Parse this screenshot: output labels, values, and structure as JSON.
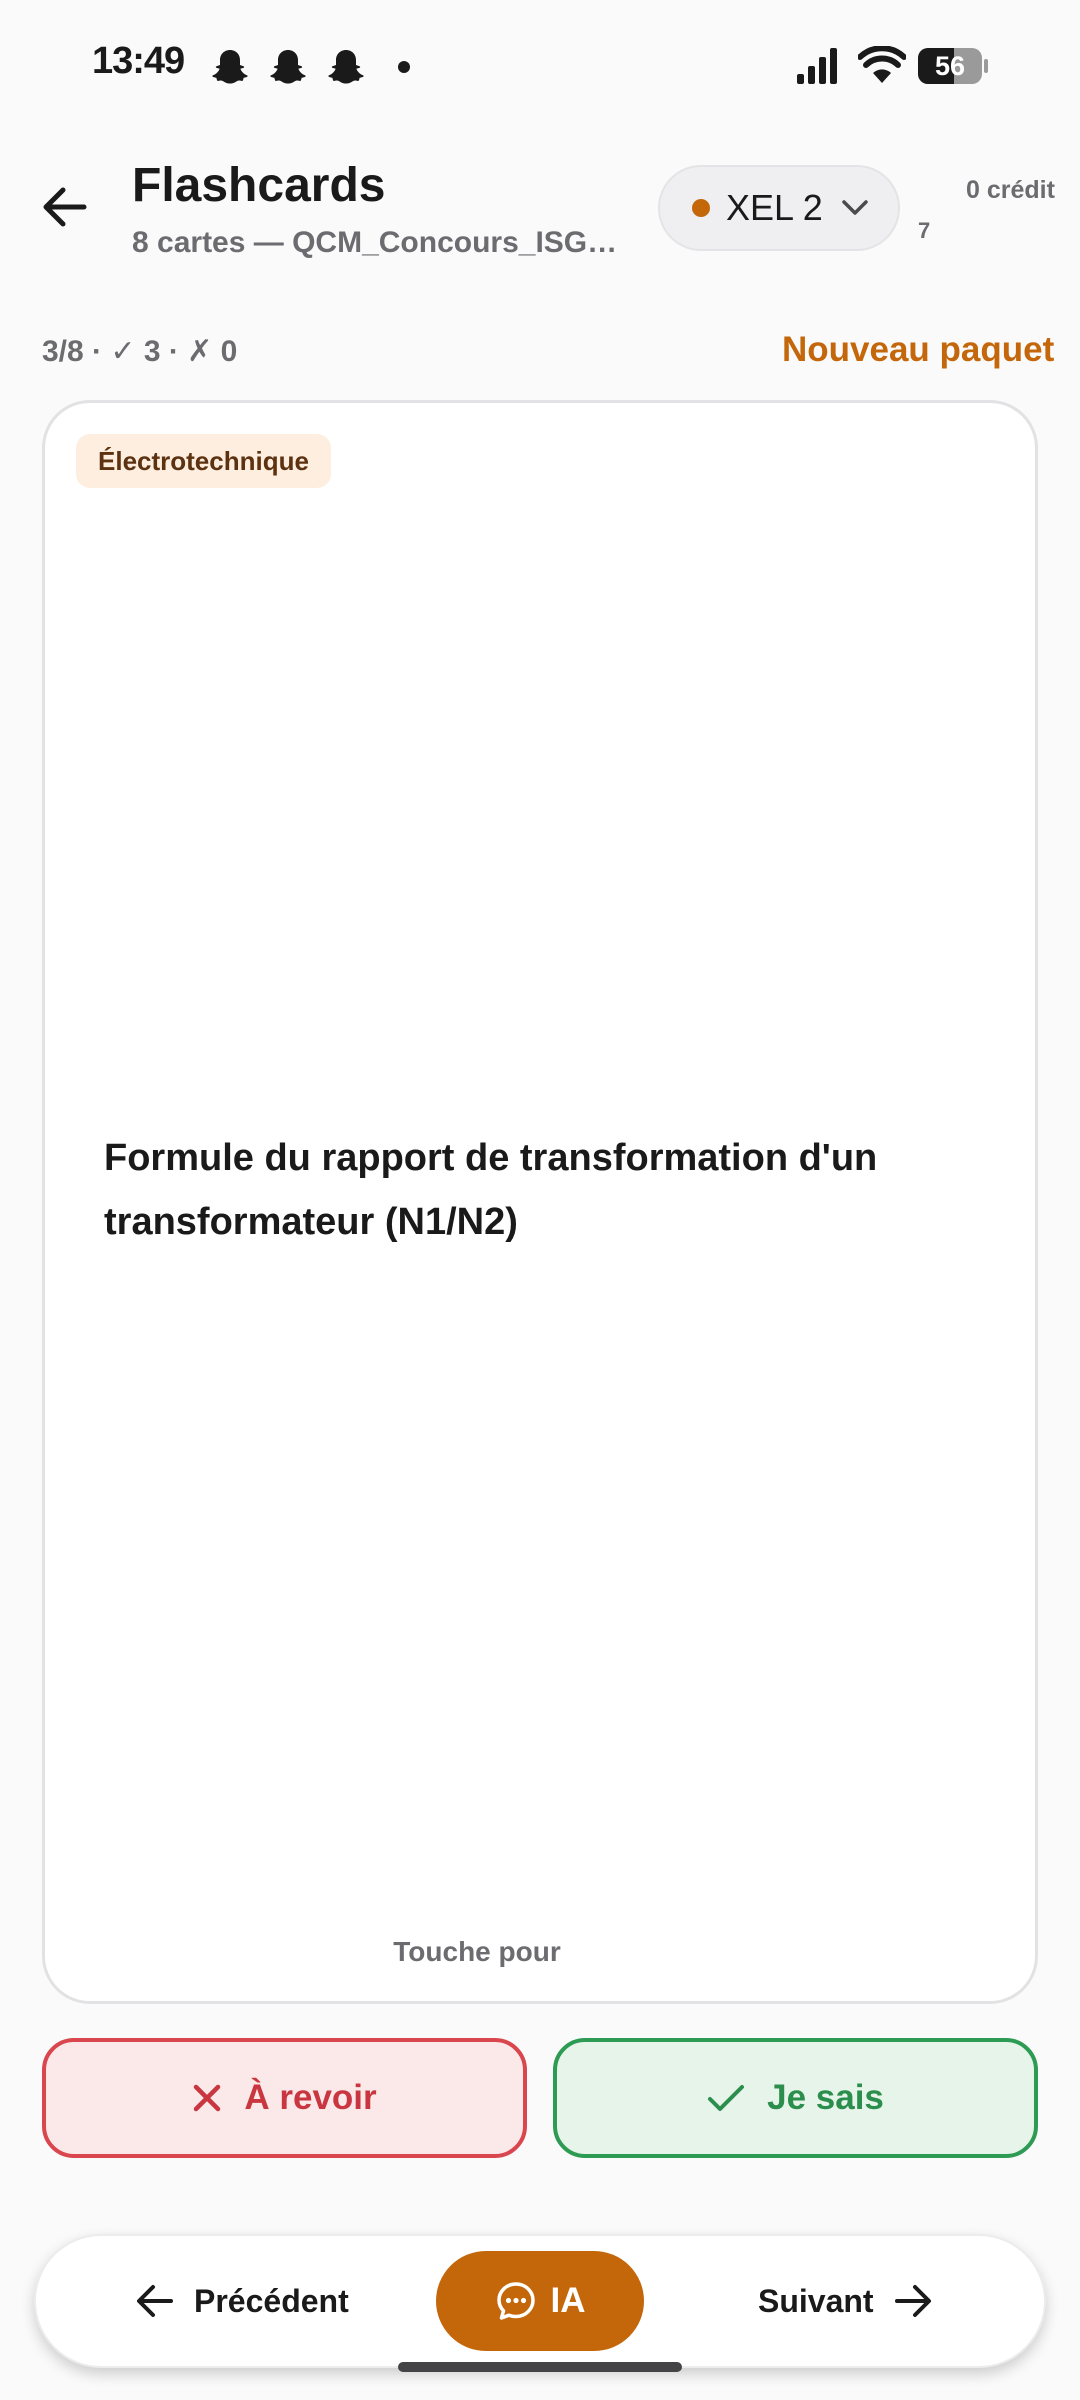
{
  "status_bar": {
    "time": "13:49",
    "battery": "56",
    "battery_level": 0.56,
    "icons": [
      "snapchat-icon",
      "snapchat-icon",
      "snapchat-icon",
      "notification-dot",
      "signal-icon",
      "wifi-icon",
      "battery-icon"
    ]
  },
  "header": {
    "title": "Flashcards",
    "subtitle": "8 cartes — QCM_Concours_ISGE-...",
    "model": "XEL 2",
    "credit": "0 crédit",
    "credit_sub": "7"
  },
  "progress": {
    "text": "3/8 · ✓ 3 · ✗ 0",
    "new_pack": "Nouveau paquet"
  },
  "card": {
    "tag": "Électrotechnique",
    "question": "Formule du rapport de transformation d'un transformateur (N1/N2)",
    "hint": "Touche pour"
  },
  "actions": {
    "review": "À revoir",
    "know": "Je sais"
  },
  "nav": {
    "prev": "Précédent",
    "ia": "IA",
    "next": "Suivant"
  },
  "colors": {
    "accent": "#c4670b",
    "danger": "#d9464e",
    "success": "#2e9b54",
    "background": "#fafafa"
  }
}
